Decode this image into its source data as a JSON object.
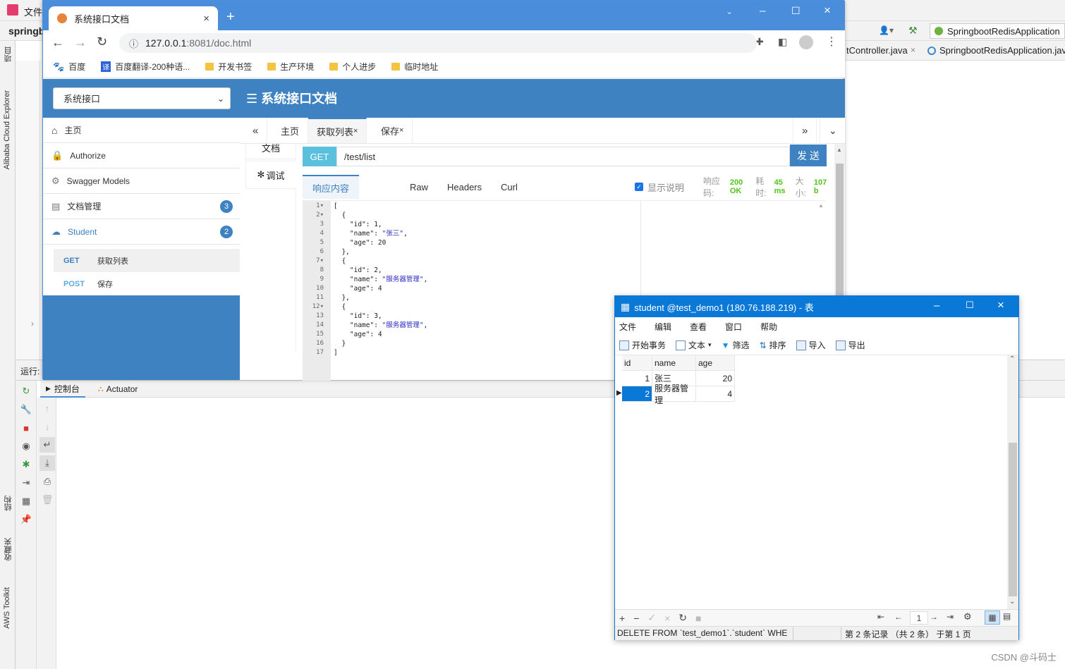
{
  "ide": {
    "menu_file": "文件",
    "project_name": "springb",
    "run_configuration": "SpringbootRedisApplication",
    "editor_tabs": [
      "tController.java",
      "SpringbootRedisApplication.java"
    ],
    "left_tools": [
      "项目",
      "Alibaba Cloud Explorer",
      "结构",
      "收藏夹",
      "AWS Toolkit"
    ],
    "run_label": "运行:",
    "run_tabs": [
      "控制台",
      "Actuator"
    ]
  },
  "browser": {
    "tab_title": "系统接口文档",
    "url_host": "127.0.0.1",
    "url_rest": ":8081/doc.html",
    "bookmarks": [
      "百度",
      "百度翻译-200种语...",
      "开发书签",
      "生产环境",
      "个人进步",
      "临时地址"
    ]
  },
  "knife4j": {
    "group_select": "系统接口",
    "title": "系统接口文档",
    "menu": [
      {
        "label": "主页"
      },
      {
        "label": "Authorize"
      },
      {
        "label": "Swagger Models"
      },
      {
        "label": "文档管理",
        "badge": "3"
      },
      {
        "label": "Student",
        "badge": "2"
      }
    ],
    "apis": [
      {
        "method": "GET",
        "name": "获取列表"
      },
      {
        "method": "POST",
        "name": "保存"
      }
    ],
    "tabs": [
      "主页",
      "获取列表",
      "保存"
    ],
    "left_tabs": [
      "文档",
      "调试"
    ],
    "method": "GET",
    "path": "/test/list",
    "send_label": "发 送",
    "response_tabs": [
      "响应内容",
      "Raw",
      "Headers",
      "Curl"
    ],
    "show_desc": "显示说明",
    "status_label": "响应码:",
    "status_value": "200 OK",
    "time_label": "耗时:",
    "time_value": "45 ms",
    "size_label": "大小:",
    "size_value": "107 b",
    "code_lines": [
      "[",
      "  {",
      "    \"id\": 1,",
      "    \"name\": \"张三\",",
      "    \"age\": 20",
      "  },",
      "  {",
      "    \"id\": 2,",
      "    \"name\": \"服务器管理\",",
      "    \"age\": 4",
      "  },",
      "  {",
      "    \"id\": 3,",
      "    \"name\": \"服务器管理\",",
      "    \"age\": 4",
      "  }",
      "]"
    ]
  },
  "navicat": {
    "title": "student @test_demo1 (180.76.188.219) - 表",
    "menu": [
      "文件",
      "编辑",
      "查看",
      "窗口",
      "帮助"
    ],
    "toolbar": [
      "开始事务",
      "文本",
      "筛选",
      "排序",
      "导入",
      "导出"
    ],
    "columns": [
      "id",
      "name",
      "age"
    ],
    "rows": [
      {
        "id": "1",
        "name": "张三",
        "age": "20"
      },
      {
        "id": "2",
        "name": "服务器管理",
        "age": "4"
      }
    ],
    "page": "1",
    "status_sql": "DELETE FROM `test_demo1`.`student` WHE",
    "status_info": "第 2 条记录 （共 2 条） 于第 1 页"
  },
  "watermark": "CSDN @斗码士"
}
